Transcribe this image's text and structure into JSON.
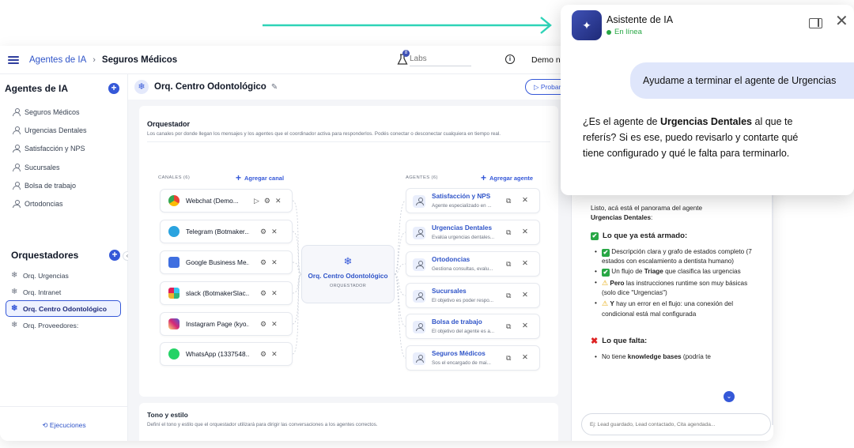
{
  "topbar": {
    "breadcrumb": [
      "Agentes de IA",
      "Seguros Médicos"
    ],
    "breadcrumb_sep": "›",
    "labs_badge": "8",
    "labs_placeholder": "Labs",
    "user": "Demo nu"
  },
  "sidebar": {
    "agents_title": "Agentes de IA",
    "agents": [
      "Seguros Médicos",
      "Urgencias Dentales",
      "Satisfacción y NPS",
      "Sucursales",
      "Bolsa de trabajo",
      "Ortodoncias"
    ],
    "orchestrators_title": "Orquestadores",
    "orchestrators": [
      "Orq. Urgencias",
      "Orq. Intranet",
      "Orq. Centro Odontológico",
      "Orq. Proveedores:"
    ],
    "executions": "Ejecuciones"
  },
  "main": {
    "title": "Orq. Centro Odontológico",
    "probar": "Probar",
    "section_title": "Orquestador",
    "section_desc": "Los canales por donde llegan los mensajes y los agentes que el coordinador activa para responderlos. Podés conectar o desconectar cualquiera en tiempo real.",
    "channels_label": "CANALES (6)",
    "add_channel": "Agregar canal",
    "agents_label": "AGENTES (6)",
    "add_agent": "Agregar agente",
    "channels": [
      {
        "name": "Webchat (Demo...",
        "icon": "chrome-icon",
        "color": "#ea4335"
      },
      {
        "name": "Telegram (Botmaker...",
        "icon": "telegram-icon",
        "color": "#2aa3df"
      },
      {
        "name": "Google Business Me...",
        "icon": "google-business-icon",
        "color": "#3f6fe0"
      },
      {
        "name": "slack (BotmakerSlac...",
        "icon": "slack-icon",
        "color": "#e01e5a"
      },
      {
        "name": "Instagram Page (kyo...",
        "icon": "instagram-icon",
        "color": "#d62976"
      },
      {
        "name": "WhatsApp (1337548...",
        "icon": "whatsapp-icon",
        "color": "#25d366"
      }
    ],
    "orchestrator_node": {
      "name": "Orq. Centro Odontológico",
      "label": "ORQUESTADOR"
    },
    "agents": [
      {
        "name": "Satisfacción y NPS",
        "desc": "Agente especializado en ..."
      },
      {
        "name": "Urgencias Dentales",
        "desc": "Evalúa urgencias dentales..."
      },
      {
        "name": "Ortodoncias",
        "desc": "Gestiona consultas, evalu..."
      },
      {
        "name": "Sucursales",
        "desc": "El objetivo es poder respo..."
      },
      {
        "name": "Bolsa de trabajo",
        "desc": "El objetivo del agente es a..."
      },
      {
        "name": "Seguros Médicos",
        "desc": "Sos el encargado de mai..."
      }
    ],
    "tone_title": "Tono y estilo",
    "tone_desc": "Definí el tono y estilo que el orquestador utilizará para dirigir las conversaciones a los agentes correctos."
  },
  "chat": {
    "intro_1": "Listo, acá está el panorama del agente",
    "intro_2": "Urgencias Dentales",
    "intro_3": ":",
    "done_title": "Lo que ya está armado:",
    "done": [
      {
        "mark": "✔",
        "text": "Descripción clara y grafo de estados completo (7 estados con escalamiento a dentista humano)"
      },
      {
        "mark": "✔",
        "pre": "Un flujo de ",
        "bold": "Triage",
        "post": " que clasifica las urgencias"
      },
      {
        "mark": "⚠",
        "bold": "Pero",
        "post": " las instrucciones runtime son muy básicas (solo dice \"Urgencias\")"
      },
      {
        "mark": "⚠",
        "bold": "Y",
        "post": " hay un error en el flujo: una conexión del condicional está mal configurada"
      }
    ],
    "missing_title": "Lo que falta:",
    "missing_1_pre": "No tiene ",
    "missing_1_bold": "knowledge bases",
    "missing_1_post": " (podría te",
    "input_placeholder": "Ej: Lead guardado, Lead contactado, Cita agendada..."
  },
  "popup": {
    "title": "Asistente de IA",
    "status": "En línea",
    "user_message": "Ayudame a terminar el agente de Urgencias",
    "bot_pre": "¿Es el agente de ",
    "bot_bold": "Urgencias Dentales",
    "bot_post": " al que te referís? Si es ese, puedo revisarlo y contarte qué tiene configurado y qué le falta para terminarlo."
  },
  "colors": {
    "accent": "#3558d8",
    "arrow": "#2ed3b7",
    "online": "#28a745",
    "user_bubble": "#dfe6fb"
  }
}
